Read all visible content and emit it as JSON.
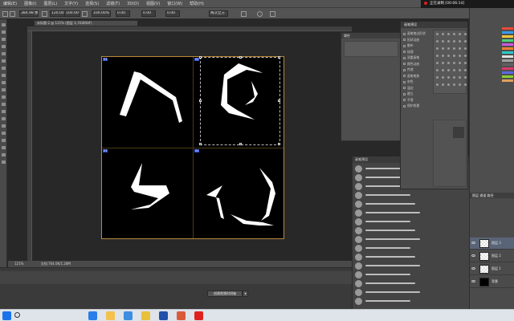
{
  "app": {
    "menu": [
      "编辑(E)",
      "图像(I)",
      "图层(L)",
      "文字(Y)",
      "选择(S)",
      "滤镜(T)",
      "3D(D)",
      "视图(V)",
      "窗口(W)",
      "帮助(H)"
    ],
    "options_bar": {
      "width_value": "384.98 像",
      "height_value": "120.00 像",
      "w_percent": "100.00%",
      "angle_value": "0.00",
      "h_percent": "100.00%",
      "x_value": "0.00",
      "y_value": "0.00",
      "interp_label": "两次立方"
    }
  },
  "document": {
    "tab_title": "未标题-2 @ 121% (图层 3, RGB/8#)",
    "status_zoom": "121%",
    "status_doc": "文档:764.0K/1.28M",
    "quadrant_labels": [
      "01",
      "02",
      "03",
      "04"
    ]
  },
  "timeline": {
    "create_button_label": "创建视频时间轴",
    "arrow_label": "▾"
  },
  "recording": {
    "text": "正在录制 [00:06:14]"
  },
  "properties_panel": {
    "title": "属性"
  },
  "brush_panel": {
    "title": "画笔预设",
    "rows": [
      "画笔笔尖形状",
      "形状动态",
      "散布",
      "纹理",
      "双重画笔",
      "颜色动态",
      "传递",
      "画笔笔势",
      "杂色",
      "湿边",
      "建立",
      "平滑",
      "保护纹理"
    ]
  },
  "brushlist_panel": {
    "title": "画笔预设"
  },
  "layers_panel": {
    "tabs_label": "图层   通道   路径",
    "layers": [
      {
        "name": "图层 3",
        "selected": true
      },
      {
        "name": "图层 2",
        "selected": false
      },
      {
        "name": "图层 1",
        "selected": false
      },
      {
        "name": "背景",
        "selected": false
      }
    ]
  },
  "colors": {
    "swatches": [
      "#e84a3a",
      "#3a9ae8",
      "#f0c83a",
      "#4ad27a",
      "#c85ae0",
      "#f07f30",
      "#30c8c8",
      "#e0e0e0",
      "#a0a0a0",
      "#606060",
      "#d83a6a",
      "#5a6ae0",
      "#8ad030",
      "#e0a060"
    ]
  },
  "taskbar": {
    "apps": [
      "edge-icon",
      "folder-icon",
      "store-icon",
      "chrome-icon",
      "ps-icon",
      "media-icon",
      "record-icon"
    ]
  }
}
